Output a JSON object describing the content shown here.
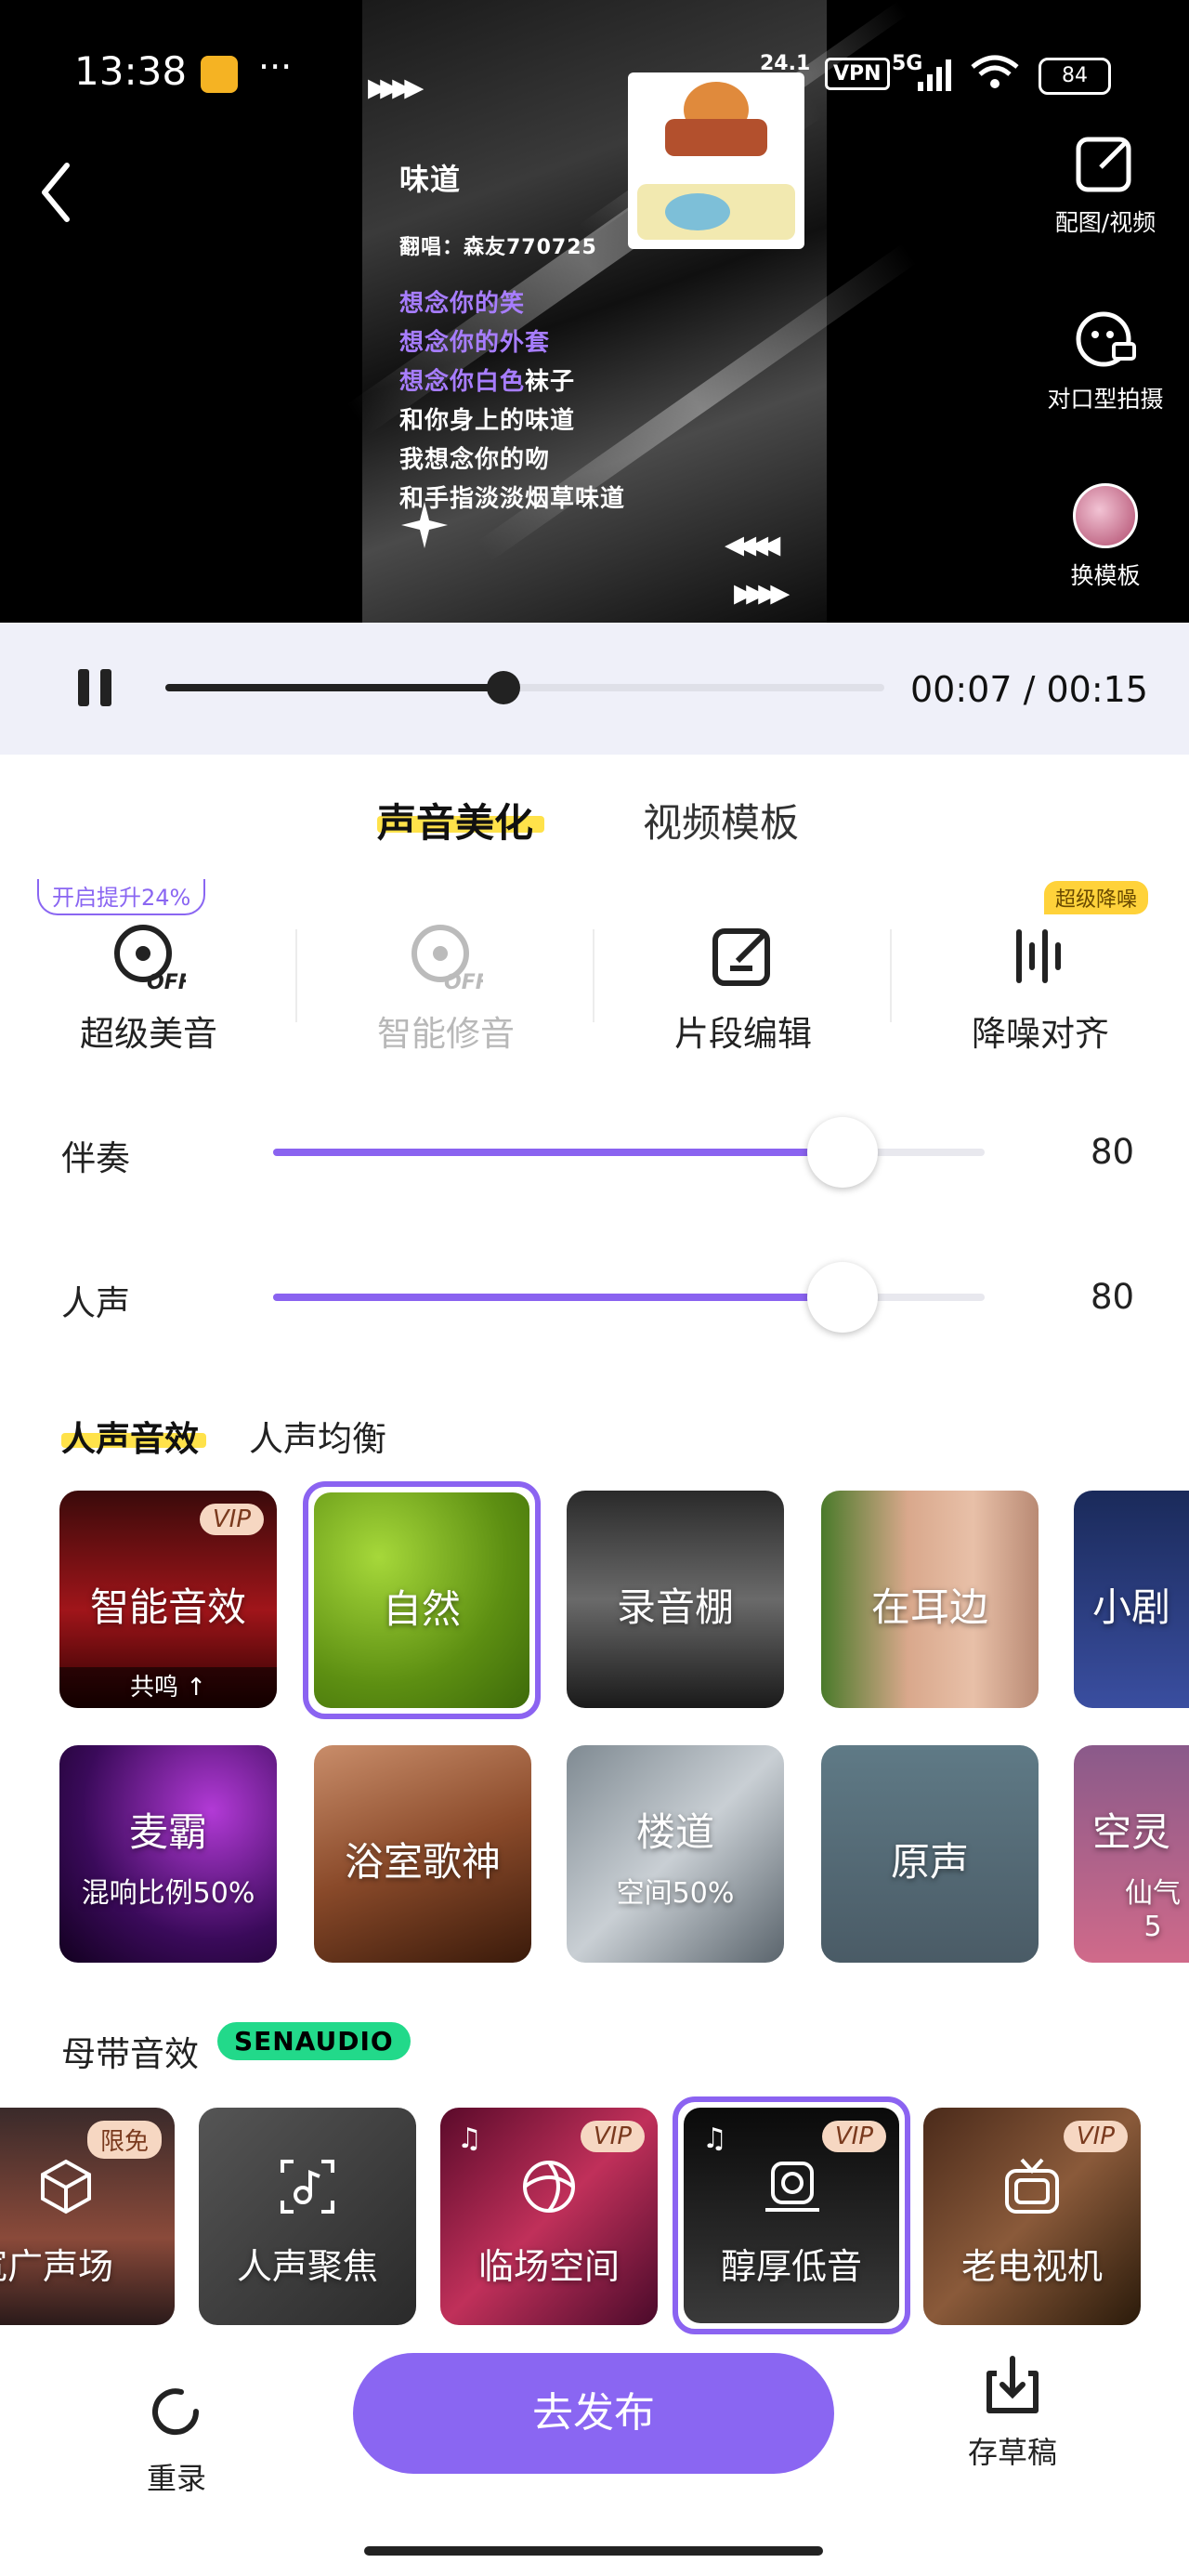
{
  "status": {
    "time": "13:38",
    "more": "···",
    "net_speed": "24.1",
    "vpn": "VPN",
    "signal": "5G",
    "battery": "84"
  },
  "video": {
    "song_title": "味道",
    "singer_line": "翻唱：森友770725",
    "lyrics": [
      "想念你的笑",
      "想念你的外套",
      "想念你白色袜子",
      "和你身上的味道",
      "我想念你的吻",
      "和手指淡淡烟草味道"
    ],
    "arrows_top": "▸▸▸▸",
    "arrows_bottom_left": "◂◂◂◂",
    "arrows_bottom_right": "▸▸▸▸",
    "side_buttons": [
      "配图/视频",
      "对口型拍摄",
      "换模板"
    ]
  },
  "player": {
    "time": "00:07 / 00:15",
    "progress": 0.47
  },
  "tabs": [
    "声音美化",
    "视频模板"
  ],
  "features": {
    "promo_badge": "开启提升24%",
    "noise_badge": "超级降噪",
    "items": [
      "超级美音",
      "智能修音",
      "片段编辑",
      "降噪对齐"
    ],
    "off_label": "OFF"
  },
  "sliders": [
    {
      "label": "伴奏",
      "value": "80",
      "level": 0.8
    },
    {
      "label": "人声",
      "value": "80",
      "level": 0.8
    }
  ],
  "effect_tabs": [
    "人声音效",
    "人声均衡"
  ],
  "effects_row1": [
    {
      "name": "智能音效",
      "sub": "共鸣 ↑",
      "badge": "VIP"
    },
    {
      "name": "自然"
    },
    {
      "name": "录音棚"
    },
    {
      "name": "在耳边"
    },
    {
      "name": "小剧"
    }
  ],
  "effects_row2": [
    {
      "name": "麦霸",
      "sub": "混响比例50%"
    },
    {
      "name": "浴室歌神"
    },
    {
      "name": "楼道",
      "sub": "空间50%"
    },
    {
      "name": "原声"
    },
    {
      "name": "空灵",
      "sub": "仙气5"
    }
  ],
  "master": {
    "title": "母带音效",
    "brand": "SENAUDIO",
    "items": [
      {
        "name": "宽广声场",
        "badge": "限免"
      },
      {
        "name": "人声聚焦"
      },
      {
        "name": "临场空间",
        "badge": "VIP"
      },
      {
        "name": "醇厚低音",
        "badge": "VIP"
      },
      {
        "name": "老电视机",
        "badge": "VIP"
      }
    ]
  },
  "bottom": {
    "rerecord": "重录",
    "publish": "去发布",
    "draft": "存草稿"
  },
  "colors": {
    "accent": "#8a66f2",
    "tab_underline": "#ffe24a"
  }
}
